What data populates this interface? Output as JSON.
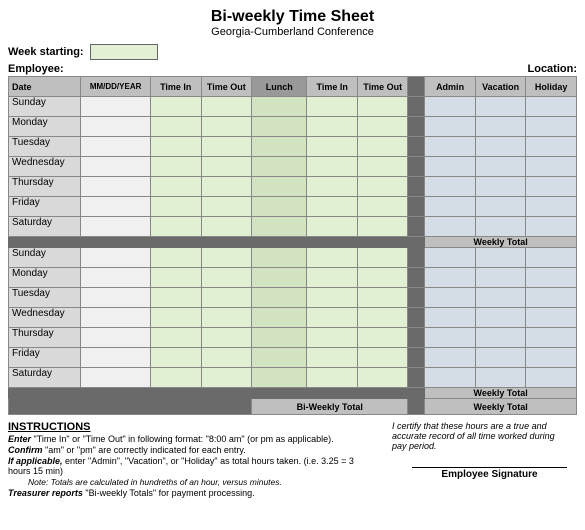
{
  "title": "Bi-weekly Time Sheet",
  "subtitle": "Georgia-Cumberland Conference",
  "labels": {
    "week_starting": "Week starting:",
    "employee": "Employee:",
    "location": "Location:"
  },
  "headers": {
    "date": "Date",
    "mdy": "MM/DD/YEAR",
    "time_in": "Time In",
    "time_out": "Time Out",
    "lunch": "Lunch",
    "admin": "Admin",
    "vacation": "Vacation",
    "holiday": "Holiday",
    "weekly_total": "Weekly Total",
    "biweekly_total": "Bi-Weekly Total"
  },
  "week1": [
    "Sunday",
    "Monday",
    "Tuesday",
    "Wednesday",
    "Thursday",
    "Friday",
    "Saturday"
  ],
  "week2": [
    "Sunday",
    "Monday",
    "Tuesday",
    "Wednesday",
    "Thursday",
    "Friday",
    "Saturday"
  ],
  "instructions": {
    "title": "INSTRUCTIONS",
    "line1_a": "Enter",
    "line1_b": " \"Time In\" or \"Time Out\" in following format: \"8:00 am\" (or pm as applicable).",
    "line2_a": "Confirm",
    "line2_b": " \"am\" or \"pm\" are correctly indicated for each entry.",
    "line3_a": "If applicable,",
    "line3_b": " enter \"Admin\", \"Vacation\", or \"Holiday\" as total hours taken. (i.e. 3.25 = 3 hours 15 min)",
    "note": "Note: Totals are calculated in hundreths of an hour, versus minutes.",
    "line4_a": "Treasurer reports",
    "line4_b": " \"Bi-weekly Totals\" for payment processing."
  },
  "certify": "I certify that these hours are a true and accurate record of all time worked during pay period.",
  "signature": "Employee Signature"
}
